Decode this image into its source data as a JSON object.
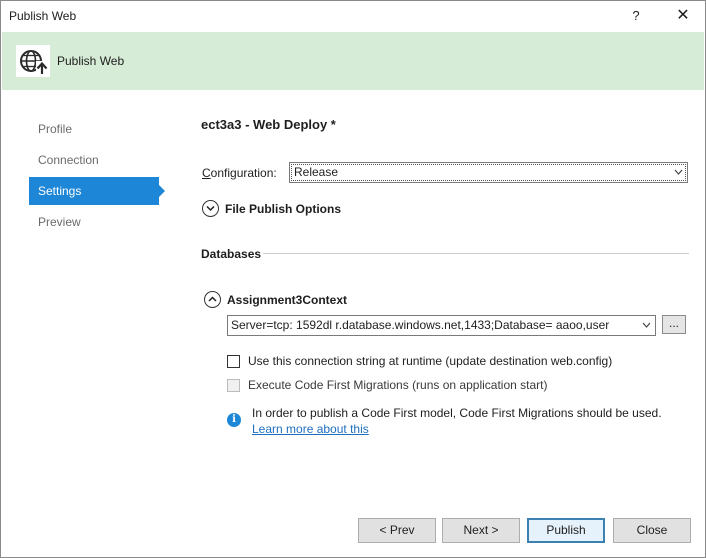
{
  "window": {
    "title": "Publish Web",
    "help_glyph": "?",
    "close_glyph": "✕"
  },
  "banner": {
    "title": "Publish Web"
  },
  "nav": {
    "items": [
      {
        "label": "Profile",
        "selected": false
      },
      {
        "label": "Connection",
        "selected": false
      },
      {
        "label": "Settings",
        "selected": true
      },
      {
        "label": "Preview",
        "selected": false
      }
    ]
  },
  "main": {
    "profile_title": "ect3a3 - Web Deploy *",
    "configuration_label": "Configuration:",
    "configuration_value": "Release",
    "file_publish_options": "File Publish Options",
    "databases_header": "Databases",
    "db_context_name": "Assignment3Context",
    "connection_string": "Server=tcp:        1592dl          r.database.windows.net,1433;Database=        aaoo,user",
    "ellipsis": "...",
    "use_conn_string_label": "Use this connection string at runtime (update destination web.config)",
    "code_first_label": "Execute Code First Migrations (runs on application start)",
    "info_icon_glyph": "i",
    "info_text": "In order to publish a Code First model, Code First Migrations should be used.",
    "info_link": "Learn more about this"
  },
  "footer": {
    "prev": "< Prev",
    "next": "Next >",
    "publish": "Publish",
    "close": "Close"
  },
  "colors": {
    "banner_bg": "#d6ecd6",
    "accent": "#1d86d6",
    "link": "#1e6fbf"
  }
}
